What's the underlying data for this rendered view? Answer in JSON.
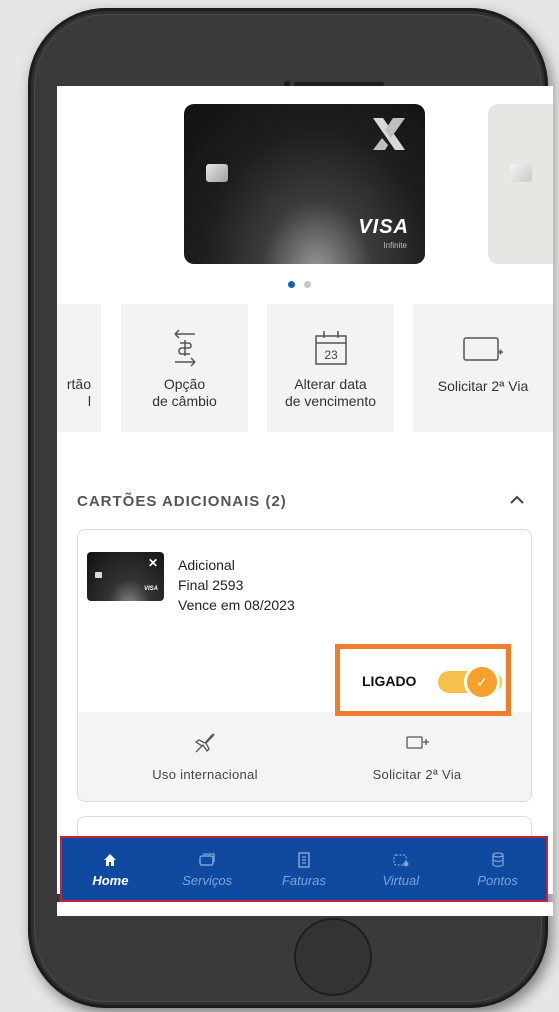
{
  "card": {
    "brand": "VISA",
    "tier": "Infinite"
  },
  "carousel": {
    "pages": 2,
    "active": 0
  },
  "actions": [
    {
      "label": "rtão\nl",
      "icon": "card-icon"
    },
    {
      "label": "Opção\nde câmbio",
      "icon": "exchange-icon"
    },
    {
      "label": "Alterar data\nde vencimento",
      "icon": "calendar-icon",
      "day": "23"
    },
    {
      "label": "Solicitar 2ª Via",
      "icon": "card-add-icon"
    }
  ],
  "section": {
    "title": "CARTÕES ADICIONAIS (2)"
  },
  "additional_card": {
    "name": "Adicional",
    "final": "Final 2593",
    "expires": "Vence em 08/2023",
    "mini_brand": "VISA",
    "toggle_label": "LIGADO",
    "toggle_on": true,
    "actions": [
      {
        "label": "Uso internacional",
        "icon": "airplane-icon"
      },
      {
        "label": "Solicitar 2ª Via",
        "icon": "card-add-icon"
      }
    ]
  },
  "nav": [
    {
      "label": "Home",
      "icon": "home-icon",
      "active": true
    },
    {
      "label": "Serviços",
      "icon": "services-icon",
      "active": false
    },
    {
      "label": "Faturas",
      "icon": "invoice-icon",
      "active": false
    },
    {
      "label": "Virtual",
      "icon": "virtual-card-icon",
      "active": false
    },
    {
      "label": "Pontos",
      "icon": "points-icon",
      "active": false
    }
  ],
  "colors": {
    "primary": "#0f4aa0",
    "highlight": "#ef7d2b",
    "toggle": "#f5a12c",
    "dot_active": "#1660b5"
  }
}
